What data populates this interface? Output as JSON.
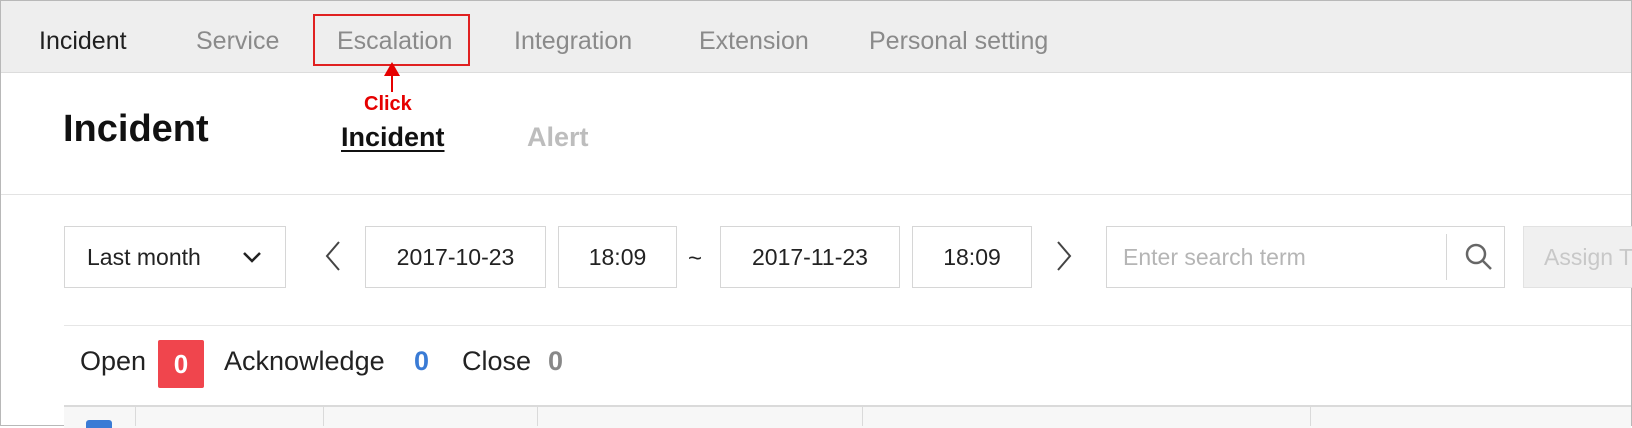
{
  "topnav": {
    "tabs": [
      {
        "label": "Incident",
        "active": true
      },
      {
        "label": "Service",
        "active": false
      },
      {
        "label": "Escalation",
        "active": false
      },
      {
        "label": "Integration",
        "active": false
      },
      {
        "label": "Extension",
        "active": false
      },
      {
        "label": "Personal setting",
        "active": false
      }
    ]
  },
  "annotation": {
    "label": "Click",
    "color": "#e60000"
  },
  "header": {
    "title": "Incident",
    "subtabs": [
      {
        "label": "Incident",
        "active": true
      },
      {
        "label": "Alert",
        "active": false
      }
    ]
  },
  "filter": {
    "range_select": "Last month",
    "start_date": "2017-10-23",
    "start_time": "18:09",
    "separator": "~",
    "end_date": "2017-11-23",
    "end_time": "18:09",
    "search_placeholder": "Enter search term",
    "assign_label": "Assign T"
  },
  "status": {
    "open_label": "Open",
    "open_count": "0",
    "ack_label": "Acknowledge",
    "ack_count": "0",
    "close_label": "Close",
    "close_count": "0"
  },
  "colors": {
    "open_badge": "#f0454d",
    "ack_count": "#3a7bd5",
    "close_count": "#888888"
  }
}
